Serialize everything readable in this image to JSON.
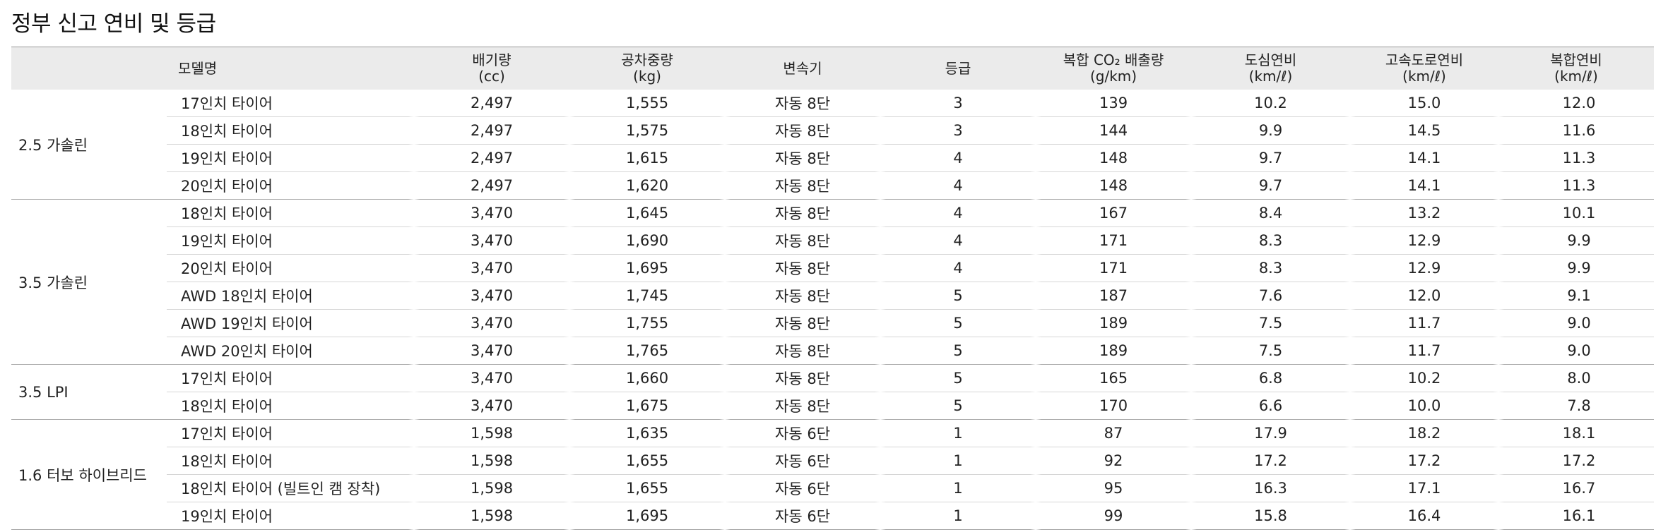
{
  "page_title": "정부 신고 연비 및 등급",
  "headers": {
    "model": "모델명",
    "displacement": "배기량",
    "displacement_unit": "(cc)",
    "weight": "공차중량",
    "weight_unit": "(kg)",
    "transmission": "변속기",
    "grade": "등급",
    "co2": "복합 CO₂ 배출량",
    "co2_unit": "(g/km)",
    "city": "도심연비",
    "city_unit": "(km/ℓ)",
    "highway": "고속도로연비",
    "highway_unit": "(km/ℓ)",
    "combined": "복합연비",
    "combined_unit": "(km/ℓ)"
  },
  "groups": [
    {
      "name": "2.5 가솔린",
      "rows": [
        [
          "17인치 타이어",
          "2,497",
          "1,555",
          "자동 8단",
          "3",
          "139",
          "10.2",
          "15.0",
          "12.0"
        ],
        [
          "18인치 타이어",
          "2,497",
          "1,575",
          "자동 8단",
          "3",
          "144",
          "9.9",
          "14.5",
          "11.6"
        ],
        [
          "19인치 타이어",
          "2,497",
          "1,615",
          "자동 8단",
          "4",
          "148",
          "9.7",
          "14.1",
          "11.3"
        ],
        [
          "20인치 타이어",
          "2,497",
          "1,620",
          "자동 8단",
          "4",
          "148",
          "9.7",
          "14.1",
          "11.3"
        ]
      ]
    },
    {
      "name": "3.5 가솔린",
      "rows": [
        [
          "18인치 타이어",
          "3,470",
          "1,645",
          "자동 8단",
          "4",
          "167",
          "8.4",
          "13.2",
          "10.1"
        ],
        [
          "19인치 타이어",
          "3,470",
          "1,690",
          "자동 8단",
          "4",
          "171",
          "8.3",
          "12.9",
          "9.9"
        ],
        [
          "20인치 타이어",
          "3,470",
          "1,695",
          "자동 8단",
          "4",
          "171",
          "8.3",
          "12.9",
          "9.9"
        ],
        [
          "AWD 18인치 타이어",
          "3,470",
          "1,745",
          "자동 8단",
          "5",
          "187",
          "7.6",
          "12.0",
          "9.1"
        ],
        [
          "AWD 19인치 타이어",
          "3,470",
          "1,755",
          "자동 8단",
          "5",
          "189",
          "7.5",
          "11.7",
          "9.0"
        ],
        [
          "AWD 20인치 타이어",
          "3,470",
          "1,765",
          "자동 8단",
          "5",
          "189",
          "7.5",
          "11.7",
          "9.0"
        ]
      ]
    },
    {
      "name": "3.5 LPI",
      "rows": [
        [
          "17인치 타이어",
          "3,470",
          "1,660",
          "자동 8단",
          "5",
          "165",
          "6.8",
          "10.2",
          "8.0"
        ],
        [
          "18인치 타이어",
          "3,470",
          "1,675",
          "자동 8단",
          "5",
          "170",
          "6.6",
          "10.0",
          "7.8"
        ]
      ]
    },
    {
      "name": "1.6 터보 하이브리드",
      "rows": [
        [
          "17인치 타이어",
          "1,598",
          "1,635",
          "자동 6단",
          "1",
          "87",
          "17.9",
          "18.2",
          "18.1"
        ],
        [
          "18인치 타이어",
          "1,598",
          "1,655",
          "자동 6단",
          "1",
          "92",
          "17.2",
          "17.2",
          "17.2"
        ],
        [
          "18인치 타이어 (빌트인 캠 장착)",
          "1,598",
          "1,655",
          "자동 6단",
          "1",
          "95",
          "16.3",
          "17.1",
          "16.7"
        ],
        [
          "19인치 타이어",
          "1,598",
          "1,695",
          "자동 6단",
          "1",
          "99",
          "15.8",
          "16.4",
          "16.1"
        ]
      ]
    }
  ]
}
